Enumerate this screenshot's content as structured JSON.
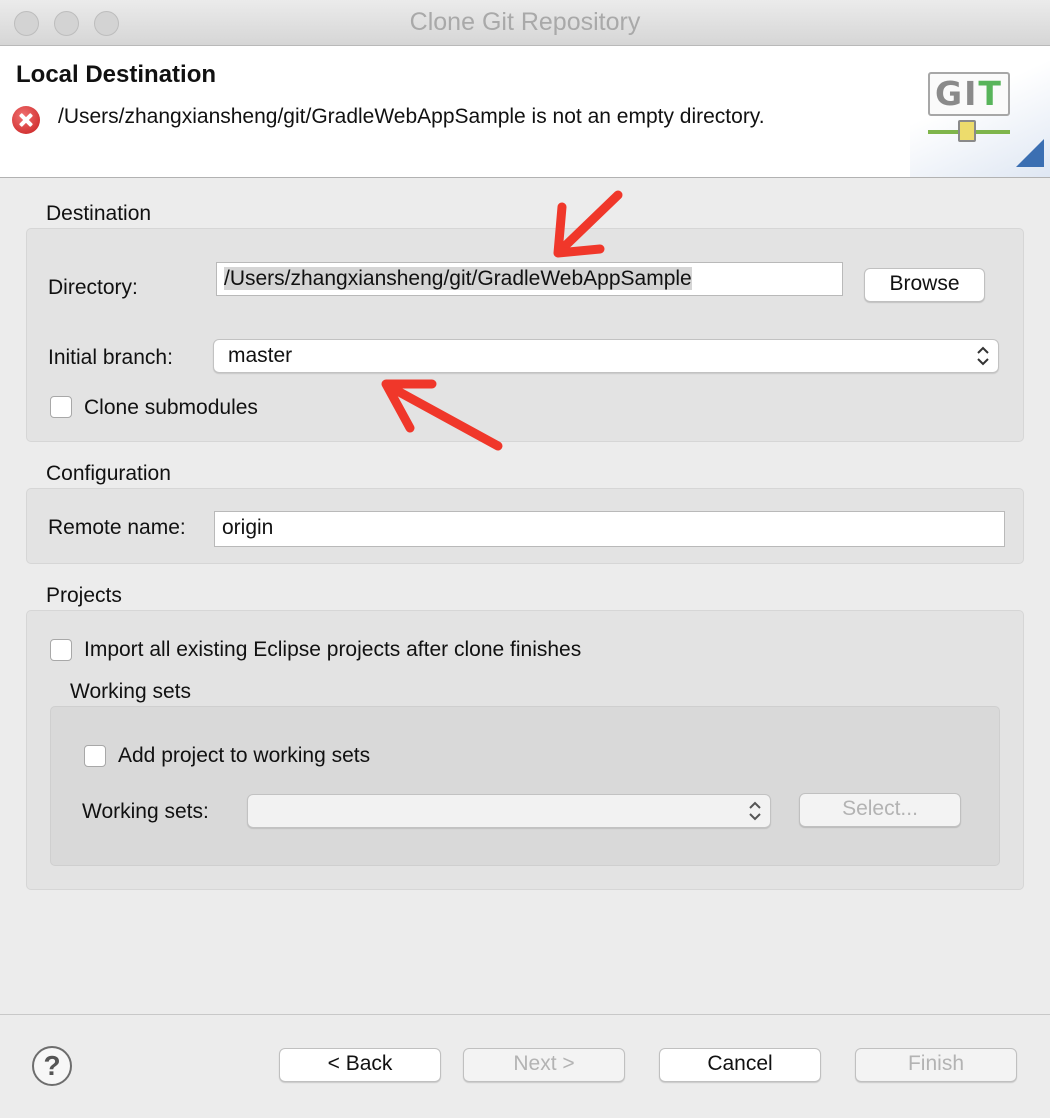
{
  "window": {
    "title": "Clone Git Repository"
  },
  "header": {
    "title": "Local Destination",
    "error_message": "/Users/zhangxiansheng/git/GradleWebAppSample is not an empty directory.",
    "logo_text_gi": "GI",
    "logo_text_t": "T"
  },
  "destination": {
    "group_title": "Destination",
    "directory_label": "Directory:",
    "directory_value": "/Users/zhangxiansheng/git/GradleWebAppSample",
    "browse_label": "Browse",
    "branch_label": "Initial branch:",
    "branch_value": "master",
    "clone_submodules_label": "Clone submodules"
  },
  "configuration": {
    "group_title": "Configuration",
    "remote_name_label": "Remote name:",
    "remote_name_value": "origin"
  },
  "projects": {
    "group_title": "Projects",
    "import_label": "Import all existing Eclipse projects after clone finishes",
    "working_sets_title": "Working sets",
    "add_to_ws_label": "Add project to working sets",
    "working_sets_label": "Working sets:",
    "working_sets_value": "",
    "select_label": "Select..."
  },
  "footer": {
    "help_icon": "?",
    "back_label": "< Back",
    "next_label": "Next >",
    "cancel_label": "Cancel",
    "finish_label": "Finish"
  },
  "annotations": {
    "arrow_color": "#f0372a"
  }
}
